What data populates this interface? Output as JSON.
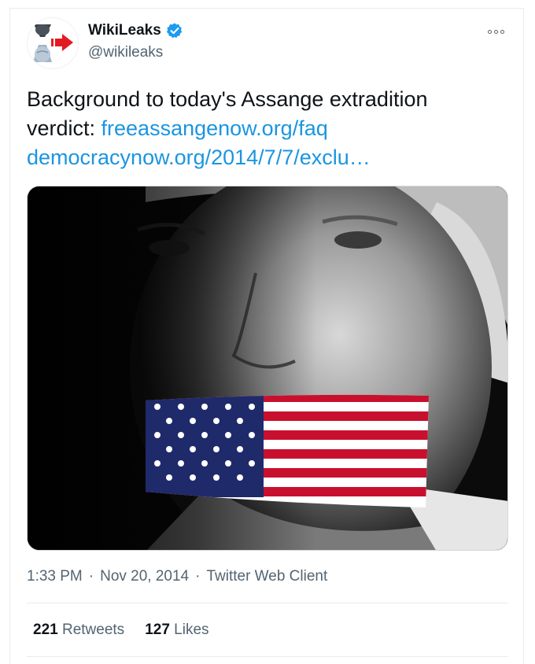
{
  "account": {
    "name": "WikiLeaks",
    "handle": "@wikileaks",
    "verified": true,
    "verified_color": "#1d9bf0"
  },
  "tweet": {
    "text_prefix": "Background to today's Assange extradition verdict: ",
    "link1": "freeassangenow.org/faq",
    "link2": "democracynow.org/2014/7/7/exclu…",
    "link_color": "#1b95e0"
  },
  "meta": {
    "time": "1:33 PM",
    "dot1": "·",
    "date": "Nov 20, 2014",
    "dot2": "·",
    "client": "Twitter Web Client"
  },
  "stats": {
    "retweets_count": "221",
    "retweets_label": "Retweets",
    "likes_count": "127",
    "likes_label": "Likes"
  },
  "icons": {
    "more": "more-options-icon",
    "verified": "verified-badge-icon",
    "avatar": "wikileaks-hourglass-logo"
  }
}
